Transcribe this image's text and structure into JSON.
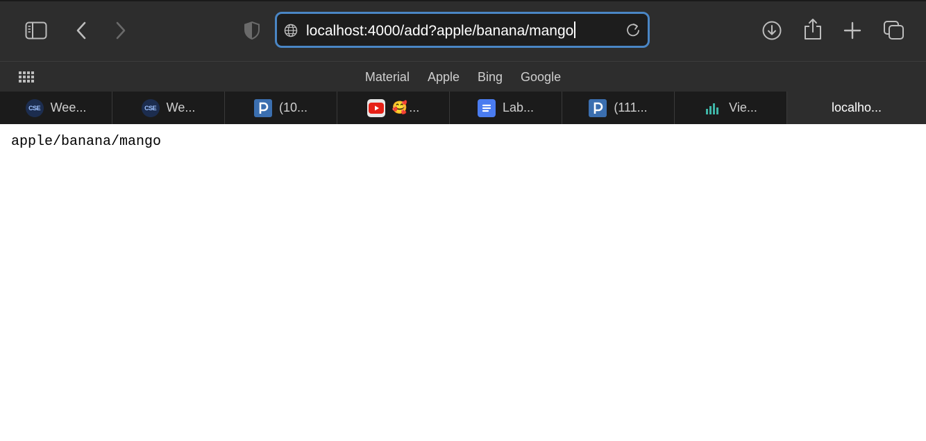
{
  "toolbar": {
    "url": "localhost:4000/add?apple/banana/mango"
  },
  "favorites": [
    "Material",
    "Apple",
    "Bing",
    "Google"
  ],
  "tabs": [
    {
      "title": "Wee...",
      "icon": "cse-icon"
    },
    {
      "title": "We...",
      "icon": "cse-icon"
    },
    {
      "title": "(10...",
      "icon": "p-icon"
    },
    {
      "title": "...",
      "icon": "youtube-icon",
      "emoji": "🥰"
    },
    {
      "title": "Lab...",
      "icon": "docs-icon"
    },
    {
      "title": "(111...",
      "icon": "p-icon"
    },
    {
      "title": "Vie...",
      "icon": "chart-icon"
    },
    {
      "title": "localho...",
      "icon": "none",
      "active": true
    }
  ],
  "page": {
    "body_text": "apple/banana/mango"
  },
  "colors": {
    "toolbar_bg": "#2d2d2d",
    "tabbar_bg": "#1b1b1b",
    "url_focus_ring": "#4a86c5"
  }
}
